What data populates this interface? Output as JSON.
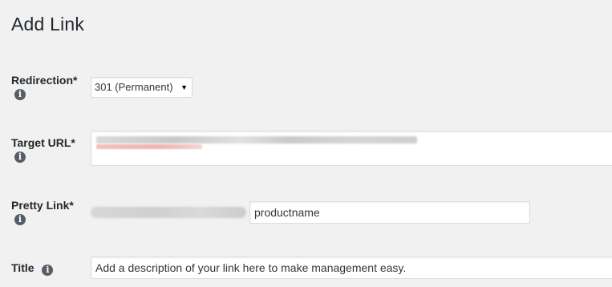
{
  "page": {
    "title": "Add Link"
  },
  "fields": {
    "redirection": {
      "label": "Redirection*",
      "value": "301 (Permanent)",
      "info_icon": "info-icon"
    },
    "target_url": {
      "label": "Target URL*",
      "value": "",
      "info_icon": "info-icon"
    },
    "pretty_link": {
      "label": "Pretty Link*",
      "slug_value": "productname",
      "info_icon": "info-icon"
    },
    "title": {
      "label": "Title",
      "placeholder": "Add a description of your link here to make management easy.",
      "info_icon": "info-icon"
    }
  },
  "colors": {
    "background": "#f1f1f1",
    "text": "#23282d",
    "icon": "#555d66",
    "input_border": "#dddddd"
  }
}
